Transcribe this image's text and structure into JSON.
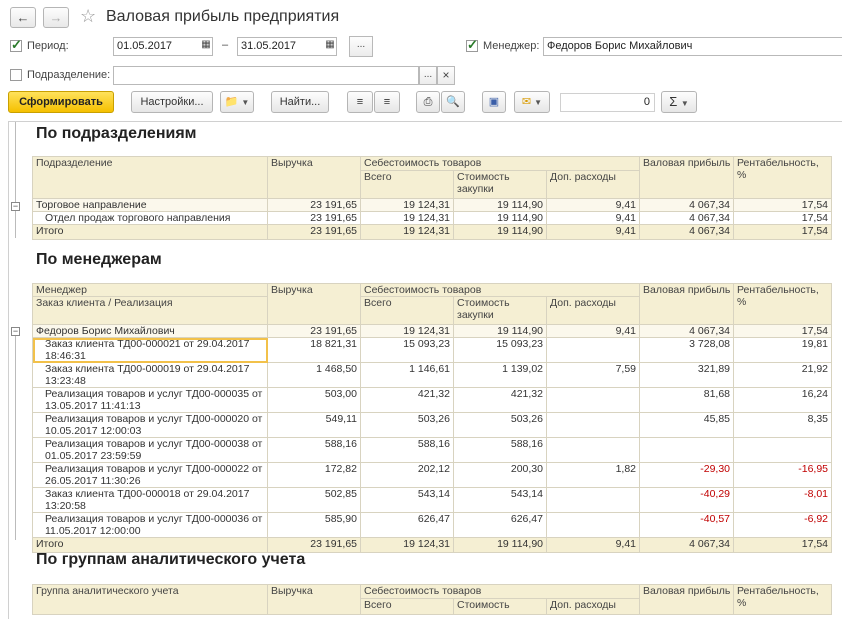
{
  "window": {
    "title": "Валовая прибыль предприятия"
  },
  "filters": {
    "period_label": "Период:",
    "period_from": "01.05.2017",
    "period_to": "31.05.2017",
    "period_dash": "–",
    "period_checked": true,
    "manager_label": "Менеджер:",
    "manager_value": "Федоров Борис Михайлович",
    "manager_checked": true,
    "division_label": "Подразделение:",
    "division_value": "",
    "division_checked": false,
    "ellipsis": "...",
    "clear": "×"
  },
  "toolbar": {
    "generate": "Сформировать",
    "settings": "Настройки...",
    "find": "Найти...",
    "counter": "0",
    "sum": "Σ"
  },
  "report": {
    "sec1": {
      "title": "По подразделениям",
      "h_division": "Подразделение",
      "h_revenue": "Выручка",
      "h_cost": "Себестоимость товаров",
      "h_total": "Всего",
      "h_purchase": "Стоимость закупки",
      "h_extra": "Доп. расходы",
      "h_gross": "Валовая прибыль",
      "h_margin": "Рентабельность, %",
      "rows": [
        {
          "name": "Торговое направление",
          "rev": "23 191,65",
          "tot": "19 124,31",
          "pur": "19 114,90",
          "ext": "9,41",
          "gp": "4 067,34",
          "mar": "17,54"
        },
        {
          "name": "Отдел продаж торгового направления",
          "rev": "23 191,65",
          "tot": "19 124,31",
          "pur": "19 114,90",
          "ext": "9,41",
          "gp": "4 067,34",
          "mar": "17,54"
        }
      ],
      "total": {
        "name": "Итого",
        "rev": "23 191,65",
        "tot": "19 124,31",
        "pur": "19 114,90",
        "ext": "9,41",
        "gp": "4 067,34",
        "mar": "17,54"
      }
    },
    "sec2": {
      "title": "По менеджерам",
      "h_manager": "Менеджер",
      "h_order": "Заказ клиента / Реализация",
      "h_revenue": "Выручка",
      "h_cost": "Себестоимость товаров",
      "h_total": "Всего",
      "h_purchase": "Стоимость закупки",
      "h_extra": "Доп. расходы",
      "h_gross": "Валовая прибыль",
      "h_margin": "Рентабельность, %",
      "group": {
        "name": "Федоров Борис Михайлович",
        "rev": "23 191,65",
        "tot": "19 124,31",
        "pur": "19 114,90",
        "ext": "9,41",
        "gp": "4 067,34",
        "mar": "17,54"
      },
      "rows": [
        {
          "name": "Заказ клиента ТД00-000021 от 29.04.2017 18:46:31",
          "rev": "18 821,31",
          "tot": "15 093,23",
          "pur": "15 093,23",
          "ext": "",
          "gp": "3 728,08",
          "mar": "19,81"
        },
        {
          "name": "Заказ клиента ТД00-000019 от 29.04.2017 13:23:48",
          "rev": "1 468,50",
          "tot": "1 146,61",
          "pur": "1 139,02",
          "ext": "7,59",
          "gp": "321,89",
          "mar": "21,92"
        },
        {
          "name": "Реализация товаров и услуг ТД00-000035 от 13.05.2017 11:41:13",
          "rev": "503,00",
          "tot": "421,32",
          "pur": "421,32",
          "ext": "",
          "gp": "81,68",
          "mar": "16,24"
        },
        {
          "name": "Реализация товаров и услуг ТД00-000020 от 10.05.2017 12:00:03",
          "rev": "549,11",
          "tot": "503,26",
          "pur": "503,26",
          "ext": "",
          "gp": "45,85",
          "mar": "8,35"
        },
        {
          "name": "Реализация товаров и услуг ТД00-000038 от 01.05.2017 23:59:59",
          "rev": "588,16",
          "tot": "588,16",
          "pur": "588,16",
          "ext": "",
          "gp": "",
          "mar": ""
        },
        {
          "name": "Реализация товаров и услуг ТД00-000022 от 26.05.2017 11:30:26",
          "rev": "172,82",
          "tot": "202,12",
          "pur": "200,30",
          "ext": "1,82",
          "gp": "-29,30",
          "mar": "-16,95"
        },
        {
          "name": "Заказ клиента ТД00-000018 от 29.04.2017 13:20:58",
          "rev": "502,85",
          "tot": "543,14",
          "pur": "543,14",
          "ext": "",
          "gp": "-40,29",
          "mar": "-8,01"
        },
        {
          "name": "Реализация товаров и услуг ТД00-000036 от 11.05.2017 12:00:00",
          "rev": "585,90",
          "tot": "626,47",
          "pur": "626,47",
          "ext": "",
          "gp": "-40,57",
          "mar": "-6,92"
        }
      ],
      "total": {
        "name": "Итого",
        "rev": "23 191,65",
        "tot": "19 124,31",
        "pur": "19 114,90",
        "ext": "9,41",
        "gp": "4 067,34",
        "mar": "17,54"
      }
    },
    "sec3": {
      "title": "По группам аналитического учета",
      "h_group": "Группа аналитического учета",
      "h_revenue": "Выручка",
      "h_cost": "Себестоимость товаров",
      "h_total": "Всего",
      "h_purchase": "Стоимость",
      "h_extra": "Доп. расходы",
      "h_gross": "Валовая прибыль",
      "h_margin": "Рентабельность, %"
    }
  }
}
